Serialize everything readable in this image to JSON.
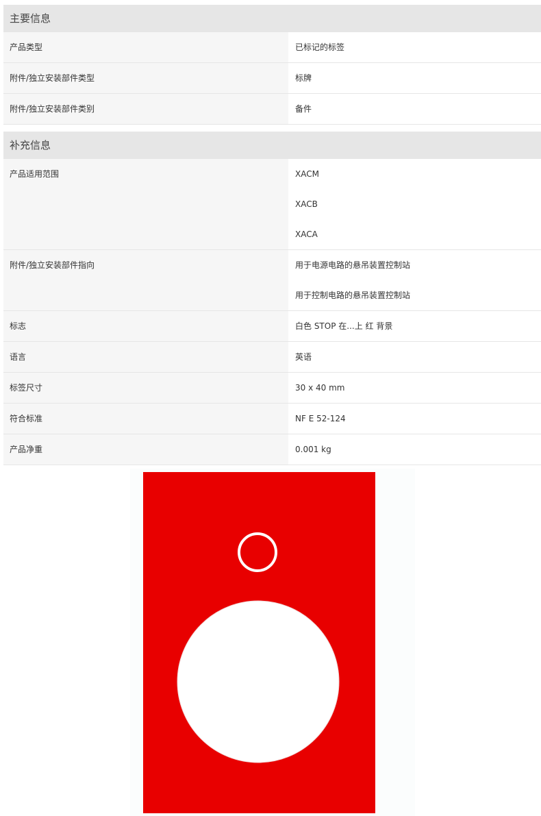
{
  "main_info": {
    "title": "主要信息",
    "rows": [
      {
        "label": "产品类型",
        "values": [
          "已标记的标签"
        ]
      },
      {
        "label": "附件/独立安装部件类型",
        "values": [
          "标牌"
        ]
      },
      {
        "label": "附件/独立安装部件类别",
        "values": [
          "备件"
        ]
      }
    ]
  },
  "extra_info": {
    "title": "补充信息",
    "rows": [
      {
        "label": "产品适用范围",
        "values": [
          "XACM",
          "XACB",
          "XACA"
        ]
      },
      {
        "label": "附件/独立安装部件指向",
        "values": [
          "用于电源电路的悬吊装置控制站",
          "用于控制电路的悬吊装置控制站"
        ]
      },
      {
        "label": "标志",
        "values": [
          "白色 STOP 在...上 红 背景"
        ]
      },
      {
        "label": "语言",
        "values": [
          "英语"
        ]
      },
      {
        "label": "标签尺寸",
        "values": [
          "30 x 40 mm"
        ]
      },
      {
        "label": "符合标准",
        "values": [
          "NF E 52-124"
        ]
      },
      {
        "label": "产品净重",
        "values": [
          "0.001 kg"
        ]
      }
    ]
  },
  "product_image": {
    "colors": {
      "background": "#e80000",
      "hole": "#ffffff"
    }
  }
}
